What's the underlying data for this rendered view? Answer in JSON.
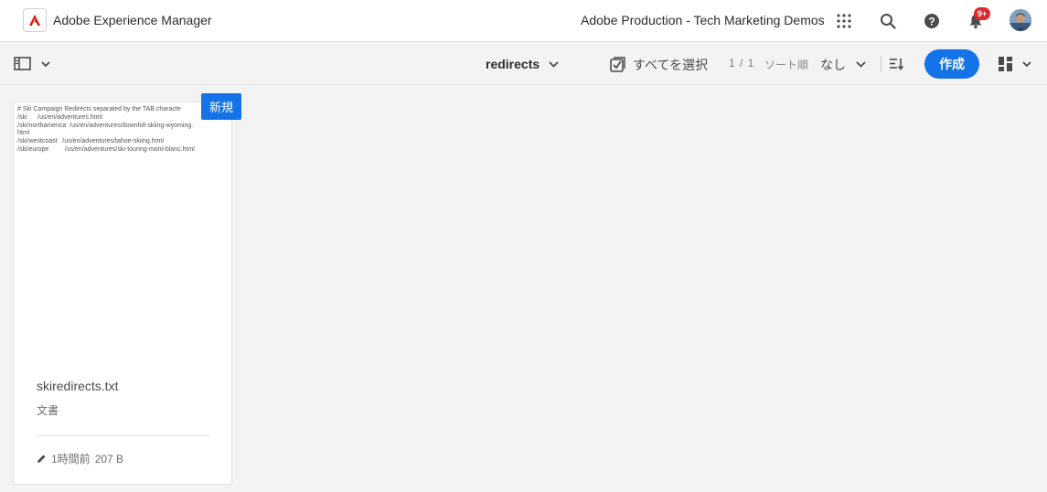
{
  "header": {
    "app_title": "Adobe Experience Manager",
    "org_name": "Adobe Production - Tech Marketing Demos",
    "notification_count": "9+",
    "icons": [
      "adobe-logo-icon",
      "apps-grid-icon",
      "search-icon",
      "help-icon",
      "bell-icon",
      "avatar"
    ],
    "brand_color": "#eb1000"
  },
  "actionbar": {
    "path_label": "redirects",
    "select_all_label": "すべてを選択",
    "count_label": "1 / 1",
    "sort_label": "ソート順",
    "sort_value": "なし",
    "create_label": "作成",
    "accent_color": "#1473e6"
  },
  "card": {
    "preview_lines": [
      "# Ski Campaign Redirects separated by the TAB characte",
      "/ski      /us/en/adventures.html",
      "/ski/northamerica  /us/en/adventures/downhill-skiing-wyoming.",
      "html",
      "/ski/westcoast   /us/en/adventures/tahoe-skiing.html",
      "/ski/europe         /us/en/adventures/ski-touring-mont-blanc.html"
    ],
    "new_badge": "新規",
    "title": "skiredirects.txt",
    "type": "文書",
    "modified": "1時間前",
    "size": "207 B"
  }
}
